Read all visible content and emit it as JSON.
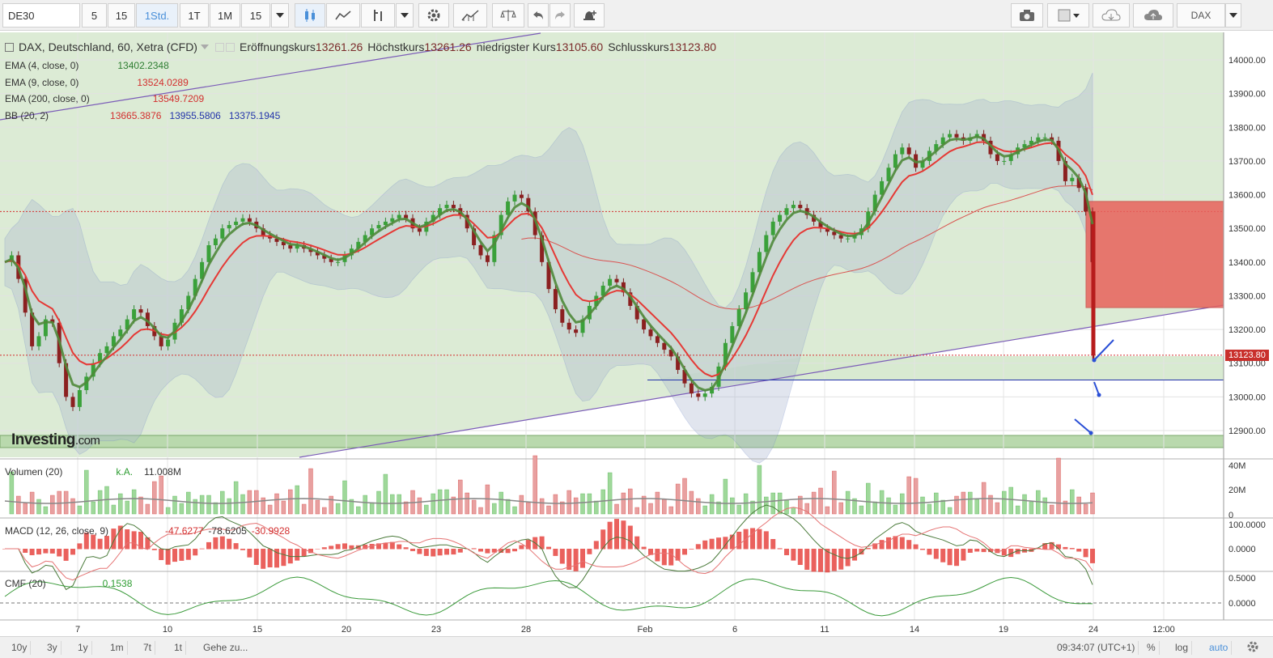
{
  "toolbar": {
    "symbol": "DE30",
    "intervals": [
      "5",
      "15",
      "1Std.",
      "1T",
      "1M",
      "15"
    ],
    "active_interval": "1Std.",
    "right_label": "DAX"
  },
  "header": {
    "title": "DAX, Deutschland, 60, Xetra (CFD)",
    "open_label": "Eröffnungskurs",
    "open": "13261.26",
    "high_label": "Höchstkurs",
    "high": "13261.26",
    "low_label": "niedrigster Kurs",
    "low": "13105.60",
    "close_label": "Schlusskurs",
    "close": "13123.80"
  },
  "indicators": {
    "ema4": {
      "label": "EMA (4, close, 0)",
      "value": "13402.2348",
      "color": "#2e7d32"
    },
    "ema9": {
      "label": "EMA (9, close, 0)",
      "value": "13524.0289",
      "color": "#d32f2f"
    },
    "ema200": {
      "label": "EMA (200, close, 0)",
      "value": "13549.7209",
      "color": "#d32f2f"
    },
    "bb": {
      "label": "BB (20, 2)",
      "v1": "13665.3876",
      "v2": "13955.5806",
      "v3": "13375.1945"
    },
    "volume": {
      "label": "Volumen (20)",
      "v1": "k.A.",
      "v2": "11.008M"
    },
    "macd": {
      "label": "MACD (12, 26, close, 9)",
      "v1": "-47.6277",
      "v2": "-78.6205",
      "v3": "-30.9928"
    },
    "cmf": {
      "label": "CMF (20)",
      "value": "0.1538"
    }
  },
  "watermark": {
    "brand": "Investing",
    "suffix": ".com"
  },
  "price_tag": "13123.80",
  "bottombar": {
    "ranges": [
      "10y",
      "3y",
      "1y",
      "1m",
      "7t",
      "1t"
    ],
    "goto": "Gehe zu...",
    "time": "09:34:07 (UTC+1)",
    "pct": "%",
    "log": "log",
    "auto": "auto"
  },
  "chart_data": {
    "type": "candlestick",
    "instrument": "DAX, Deutschland, 60, Xetra (CFD)",
    "x_ticks": [
      "7",
      "10",
      "15",
      "20",
      "23",
      "28",
      "Feb",
      "6",
      "11",
      "14",
      "19",
      "24",
      "12:00"
    ],
    "y_ticks": [
      "14000.00",
      "13900.00",
      "13800.00",
      "13700.00",
      "13600.00",
      "13500.00",
      "13400.00",
      "13300.00",
      "13200.00",
      "13100.00",
      "13000.00",
      "12900.00"
    ],
    "ylim": [
      12850,
      14020
    ],
    "close_path": [
      13400,
      13420,
      13350,
      13250,
      13150,
      13180,
      13230,
      13220,
      13100,
      13000,
      12970,
      13020,
      13060,
      13100,
      13130,
      13150,
      13180,
      13200,
      13230,
      13260,
      13250,
      13210,
      13180,
      13150,
      13170,
      13220,
      13260,
      13300,
      13350,
      13400,
      13450,
      13470,
      13500,
      13510,
      13520,
      13530,
      13520,
      13500,
      13480,
      13470,
      13460,
      13450,
      13440,
      13450,
      13440,
      13430,
      13420,
      13410,
      13400,
      13400,
      13420,
      13440,
      13460,
      13480,
      13500,
      13510,
      13520,
      13530,
      13540,
      13530,
      13500,
      13490,
      13520,
      13540,
      13560,
      13570,
      13560,
      13540,
      13500,
      13450,
      13420,
      13400,
      13480,
      13540,
      13580,
      13600,
      13590,
      13550,
      13480,
      13400,
      13320,
      13260,
      13220,
      13200,
      13190,
      13230,
      13270,
      13300,
      13330,
      13350,
      13340,
      13310,
      13270,
      13230,
      13200,
      13180,
      13160,
      13140,
      13120,
      13080,
      13040,
      13010,
      13000,
      13010,
      13030,
      13090,
      13160,
      13210,
      13260,
      13310,
      13370,
      13430,
      13480,
      13520,
      13540,
      13560,
      13570,
      13560,
      13540,
      13520,
      13500,
      13490,
      13480,
      13470,
      13470,
      13480,
      13500,
      13550,
      13600,
      13640,
      13680,
      13720,
      13740,
      13720,
      13680,
      13700,
      13730,
      13750,
      13770,
      13780,
      13770,
      13760,
      13770,
      13780,
      13760,
      13720,
      13700,
      13700,
      13720,
      13740,
      13750,
      13760,
      13770,
      13770,
      13760,
      13700,
      13640,
      13650,
      13620,
      13550,
      13400
    ],
    "last_drop": {
      "open": 13261.26,
      "high": 13261.26,
      "low": 13105.6,
      "close": 13123.8
    },
    "horizontal_levels": [
      13550,
      13123.8,
      13050
    ],
    "zone_top": 13580,
    "zone_bottom": 13265,
    "volume_ticks": [
      "40M",
      "20M",
      "0"
    ],
    "macd_ticks": [
      "100.0000",
      "0.0000"
    ],
    "cmf_ticks": [
      "0.5000",
      "0.0000"
    ]
  }
}
